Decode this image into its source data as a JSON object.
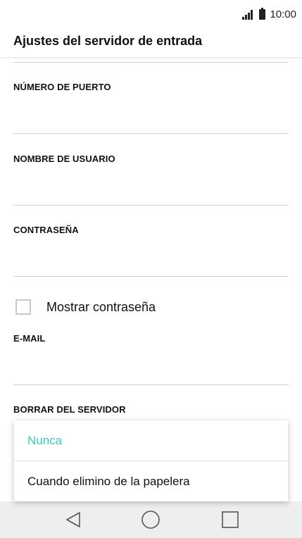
{
  "status": {
    "time": "10:00"
  },
  "header": {
    "title": "Ajustes del servidor de entrada"
  },
  "fields": [
    {
      "label": "NÚMERO DE PUERTO",
      "value": ""
    },
    {
      "label": "NOMBRE DE USUARIO",
      "value": ""
    },
    {
      "label": "CONTRASEÑA",
      "value": ""
    },
    {
      "label": "E-MAIL",
      "value": ""
    },
    {
      "label": "BORRAR DEL SERVIDOR"
    }
  ],
  "show_password": {
    "label": "Mostrar contraseña",
    "checked": false
  },
  "delete_dialog": {
    "options": [
      {
        "label": "Nunca",
        "selected": true
      },
      {
        "label": "Cuando elimino de la papelera",
        "selected": false
      }
    ]
  },
  "nav": {
    "back": "back-icon",
    "home": "home-icon",
    "recents": "recents-icon"
  },
  "colors": {
    "accent": "#3dc9b4",
    "divider": "#cfcfcf",
    "nav_bg": "#eceef0"
  }
}
